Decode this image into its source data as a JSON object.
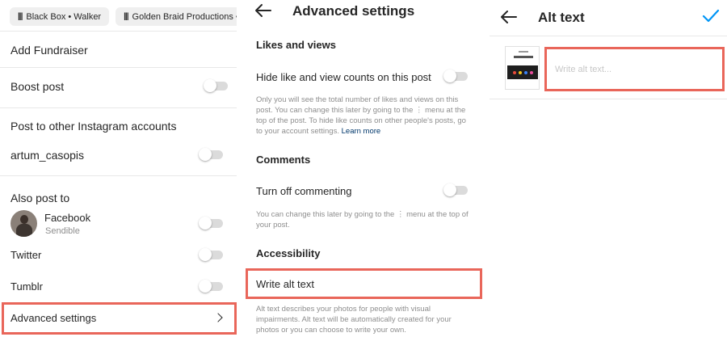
{
  "panel1": {
    "chips": [
      {
        "label": "Black Box • Walker"
      },
      {
        "label": "Golden Braid Productions • H"
      }
    ],
    "add_fundraiser": "Add Fundraiser",
    "boost_post": "Boost post",
    "post_other_accounts": "Post to other Instagram accounts",
    "account_name": "artum_casopis",
    "also_post_to": "Also post to",
    "facebook": {
      "label": "Facebook",
      "sub": "Sendible"
    },
    "twitter": "Twitter",
    "tumblr": "Tumblr",
    "advanced_settings": "Advanced settings"
  },
  "panel2": {
    "title": "Advanced settings",
    "likes_section": "Likes and views",
    "hide_counts": "Hide like and view counts on this post",
    "hide_counts_desc": "Only you will see the total number of likes and views on this post. You can change this later by going to the ⋮ menu at the top of the post. To hide like counts on other people's posts, go to your account settings.",
    "learn_more": "Learn more",
    "comments_section": "Comments",
    "turn_off_commenting": "Turn off commenting",
    "commenting_desc": "You can change this later by going to the ⋮ menu at the top of your post.",
    "accessibility_section": "Accessibility",
    "write_alt_text": "Write alt text",
    "alt_text_desc": "Alt text describes your photos for people with visual impairments. Alt text will be automatically created for your photos or you can choose to write your own."
  },
  "panel3": {
    "title": "Alt text",
    "alt_input": {
      "value": "",
      "placeholder": "Write alt text..."
    }
  },
  "colors": {
    "highlight": "#e9665a",
    "accent_check": "#0095f6",
    "link": "#00376b",
    "muted_text": "#8e8e8e",
    "toggle_track": "#dbdbdb"
  },
  "toggles": {
    "boost_post": false,
    "account": false,
    "facebook": false,
    "twitter": false,
    "tumblr": false,
    "hide_counts": false,
    "turn_off_commenting": false
  },
  "icons": [
    "back-arrow-icon",
    "chevron-right-icon",
    "checkmark-icon",
    "bars-icon"
  ]
}
